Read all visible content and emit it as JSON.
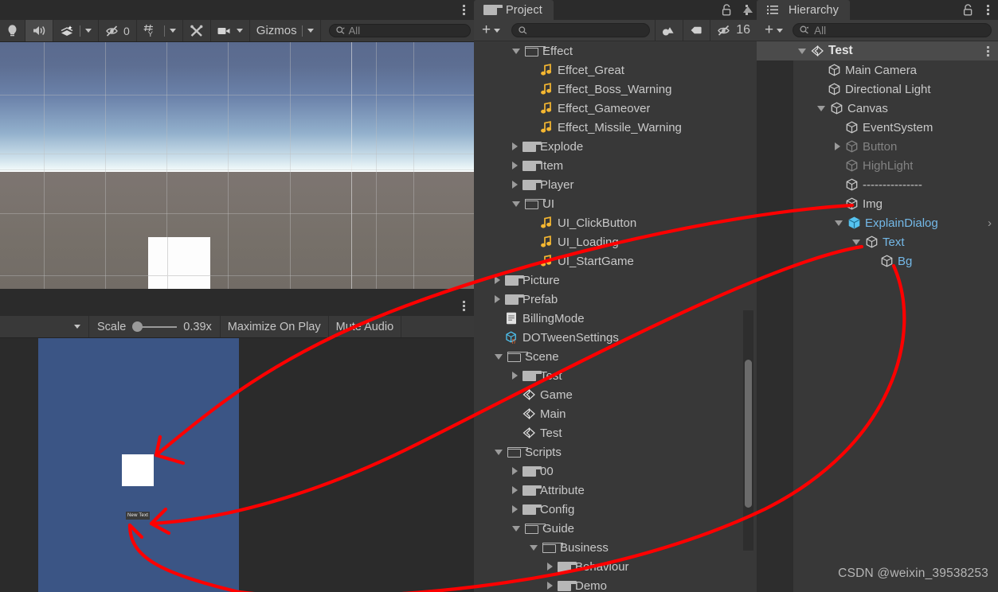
{
  "scene_view": {
    "tab_label": "",
    "toolbar": {
      "lighting_icon": "lightbulb-icon",
      "audio_icon": "speaker-icon",
      "fx_icon": "effects-icon",
      "hidden_objects_count": "0",
      "grid_icon": "grid-snap-icon",
      "tools_icon": "scene-tools-icon",
      "camera_icon": "scene-camera-icon",
      "gizmos_label": "Gizmos",
      "search_placeholder": "All",
      "search_value": ""
    },
    "kebab_icon": "more-options-icon"
  },
  "game_view": {
    "toolbar": {
      "display_caret": "chevron-down-icon",
      "scale_label": "Scale",
      "scale_value": "0.39x",
      "maximize_label": "Maximize On Play",
      "mute_label": "Mute Audio"
    },
    "canvas": {
      "background_color": "#3b5585",
      "text_object_label": "New Text"
    },
    "kebab_icon": "more-options-icon"
  },
  "project_panel": {
    "tab_label": "Project",
    "lock_icon": "lock-icon",
    "kebab_icon": "more-options-icon",
    "toolbar": {
      "create_label": "+",
      "create_caret": "chevron-down-icon",
      "search_placeholder": "",
      "search_value": "",
      "filter_type_icon": "filter-by-type-icon",
      "filter_label_icon": "filter-by-label-icon",
      "hidden_icon": "hidden-eye-icon",
      "hidden_count": "16"
    },
    "tree": [
      {
        "label": "Effect",
        "depth": 1,
        "icon": "folder-open",
        "state": "open"
      },
      {
        "label": "Effcet_Great",
        "depth": 2,
        "icon": "audio",
        "state": "leaf"
      },
      {
        "label": "Effect_Boss_Warning",
        "depth": 2,
        "icon": "audio",
        "state": "leaf"
      },
      {
        "label": "Effect_Gameover",
        "depth": 2,
        "icon": "audio",
        "state": "leaf"
      },
      {
        "label": "Effect_Missile_Warning",
        "depth": 2,
        "icon": "audio",
        "state": "leaf"
      },
      {
        "label": "Explode",
        "depth": 1,
        "icon": "folder",
        "state": "closed"
      },
      {
        "label": "Item",
        "depth": 1,
        "icon": "folder",
        "state": "closed"
      },
      {
        "label": "Player",
        "depth": 1,
        "icon": "folder",
        "state": "closed"
      },
      {
        "label": "UI",
        "depth": 1,
        "icon": "folder-open",
        "state": "open"
      },
      {
        "label": "UI_ClickButton",
        "depth": 2,
        "icon": "audio",
        "state": "leaf"
      },
      {
        "label": "UI_Loading",
        "depth": 2,
        "icon": "audio",
        "state": "leaf"
      },
      {
        "label": "UI_StartGame",
        "depth": 2,
        "icon": "audio",
        "state": "leaf"
      },
      {
        "label": "Picture",
        "depth": 0,
        "icon": "folder",
        "state": "closed"
      },
      {
        "label": "Prefab",
        "depth": 0,
        "icon": "folder",
        "state": "closed"
      },
      {
        "label": "BillingMode",
        "depth": 0,
        "icon": "textasset",
        "state": "leaf"
      },
      {
        "label": "DOTweenSettings",
        "depth": 0,
        "icon": "scriptableobj",
        "state": "leaf"
      },
      {
        "label": "Scene",
        "depth": 0,
        "icon": "folder-open",
        "state": "open"
      },
      {
        "label": "Test",
        "depth": 1,
        "icon": "folder",
        "state": "closed"
      },
      {
        "label": "Game",
        "depth": 1,
        "icon": "unity-scene",
        "state": "leaf"
      },
      {
        "label": "Main",
        "depth": 1,
        "icon": "unity-scene",
        "state": "leaf"
      },
      {
        "label": "Test",
        "depth": 1,
        "icon": "unity-scene",
        "state": "leaf"
      },
      {
        "label": "Scripts",
        "depth": 0,
        "icon": "folder-open",
        "state": "open"
      },
      {
        "label": "00",
        "depth": 1,
        "icon": "folder",
        "state": "closed"
      },
      {
        "label": "Attribute",
        "depth": 1,
        "icon": "folder",
        "state": "closed"
      },
      {
        "label": "Config",
        "depth": 1,
        "icon": "folder",
        "state": "closed"
      },
      {
        "label": "Guide",
        "depth": 1,
        "icon": "folder-open",
        "state": "open"
      },
      {
        "label": "Business",
        "depth": 2,
        "icon": "folder-open",
        "state": "open"
      },
      {
        "label": "Behaviour",
        "depth": 3,
        "icon": "folder",
        "state": "closed"
      },
      {
        "label": "Demo",
        "depth": 3,
        "icon": "folder",
        "state": "closed"
      }
    ]
  },
  "hierarchy_panel": {
    "tab_label": "Hierarchy",
    "tab_icon": "hierarchy-list-icon",
    "lock_icon": "lock-icon",
    "kebab_icon": "more-options-icon",
    "toolbar": {
      "create_label": "+",
      "create_caret": "chevron-down-icon",
      "search_placeholder": "All",
      "search_value": ""
    },
    "scene_row": {
      "label": "Test",
      "icon": "unity-scene",
      "state": "open",
      "kebab_icon": "more-options-icon"
    },
    "tree": [
      {
        "label": "Main Camera",
        "depth": 1,
        "state": "leaf",
        "style": "normal"
      },
      {
        "label": "Directional Light",
        "depth": 1,
        "state": "leaf",
        "style": "normal"
      },
      {
        "label": "Canvas",
        "depth": 1,
        "state": "open",
        "style": "normal"
      },
      {
        "label": "EventSystem",
        "depth": 2,
        "state": "leaf",
        "style": "normal"
      },
      {
        "label": "Button",
        "depth": 2,
        "state": "closed",
        "style": "disabled"
      },
      {
        "label": "HighLight",
        "depth": 2,
        "state": "leaf",
        "style": "disabled"
      },
      {
        "label": "---------------",
        "depth": 2,
        "state": "leaf",
        "style": "normal"
      },
      {
        "label": "Img",
        "depth": 2,
        "state": "leaf",
        "style": "normal"
      },
      {
        "label": "ExplainDialog",
        "depth": 2,
        "state": "open",
        "style": "prefab"
      },
      {
        "label": "Text",
        "depth": 3,
        "state": "open",
        "style": "prefab-child"
      },
      {
        "label": "Bg",
        "depth": 4,
        "state": "leaf",
        "style": "prefab-child"
      }
    ]
  },
  "watermark": {
    "text": "CSDN @weixin_39538253"
  },
  "colors": {
    "panel_bg": "#383838",
    "toolbar_bg": "#3c3c3c",
    "tabbar_bg": "#2b2b2b",
    "selection_row": "#4b4b4b",
    "prefab_blue": "#6fb8e8",
    "audio_yellow": "#f5b731",
    "annotation_red": "#ff0000",
    "game_bg_blue": "#3b5585"
  }
}
